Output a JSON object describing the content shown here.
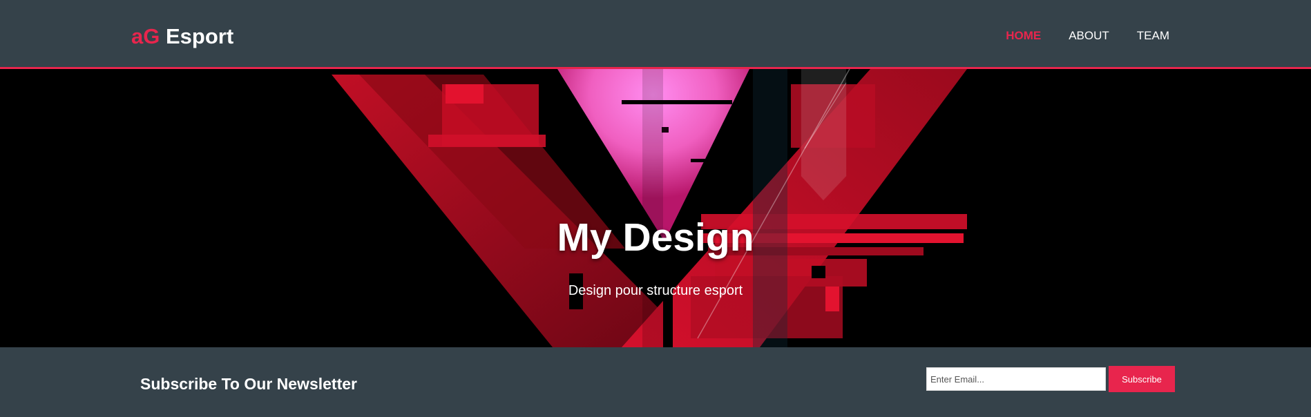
{
  "header": {
    "logo_highlight": "aG",
    "logo_rest": " Esport",
    "nav": [
      {
        "label": "HOME",
        "active": true
      },
      {
        "label": "ABOUT",
        "active": false
      },
      {
        "label": "TEAM",
        "active": false
      }
    ]
  },
  "showcase": {
    "title": "My Design",
    "subtitle": "Design pour structure esport"
  },
  "newsletter": {
    "title": "Subscribe To Our Newsletter",
    "email_placeholder": "Enter Email...",
    "subscribe_label": "Subscribe"
  },
  "colors": {
    "accent": "#e8254d",
    "background": "#35424a",
    "hero_background": "#000000"
  }
}
